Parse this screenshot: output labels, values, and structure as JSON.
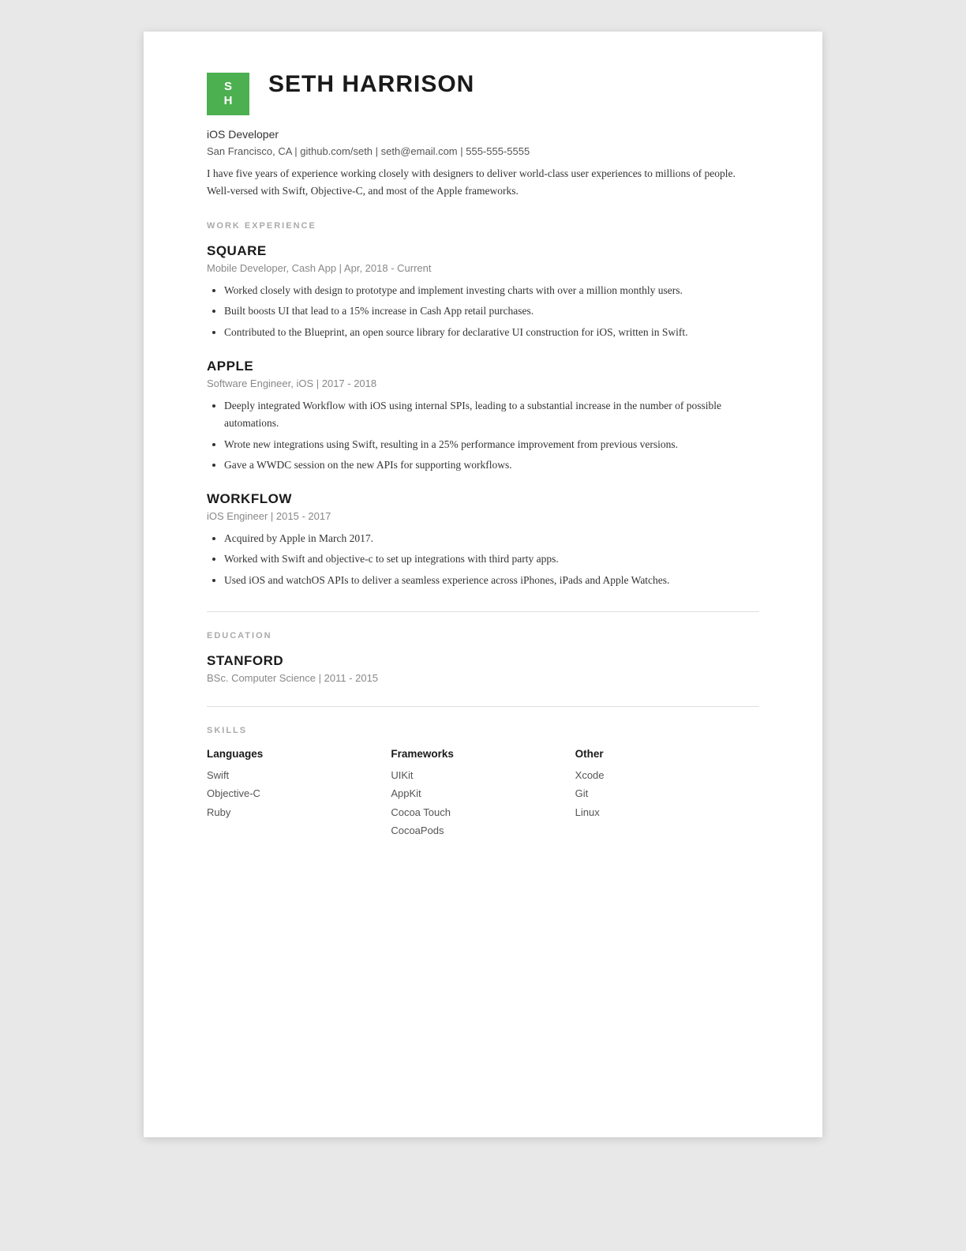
{
  "avatar": {
    "line1": "S",
    "line2": "H",
    "bg_color": "#4caf50"
  },
  "header": {
    "name": "SETH HARRISON",
    "title": "iOS Developer",
    "contact": "San Francisco, CA | github.com/seth | seth@email.com | 555-555-5555",
    "summary": "I have five years of experience working closely with designers to deliver world-class user experiences to millions of people. Well-versed with Swift, Objective-C, and most of the Apple frameworks."
  },
  "sections": {
    "work_experience_label": "WORK EXPERIENCE",
    "education_label": "EDUCATION",
    "skills_label": "SKILLS"
  },
  "work_experience": [
    {
      "company": "SQUARE",
      "meta": "Mobile Developer, Cash App | Apr, 2018 - Current",
      "bullets": [
        "Worked closely with design to prototype and implement investing charts with over a million monthly users.",
        "Built boosts UI that lead to a 15% increase in Cash App retail purchases.",
        "Contributed to the Blueprint, an open source library for declarative UI construction for iOS, written in Swift."
      ]
    },
    {
      "company": "APPLE",
      "meta": "Software Engineer, iOS | 2017 - 2018",
      "bullets": [
        "Deeply integrated Workflow with iOS using internal SPIs, leading to a substantial increase in the number of possible automations.",
        "Wrote new integrations using Swift, resulting in a 25% performance improvement from previous versions.",
        "Gave a WWDC session on the new APIs for supporting workflows."
      ]
    },
    {
      "company": "WORKFLOW",
      "meta": "iOS Engineer | 2015 - 2017",
      "bullets": [
        "Acquired by Apple in March 2017.",
        "Worked with Swift and objective-c to set up integrations with third party apps.",
        "Used iOS and watchOS APIs to deliver a seamless experience across iPhones, iPads and Apple Watches."
      ]
    }
  ],
  "education": [
    {
      "school": "STANFORD",
      "meta": "BSc. Computer Science | 2011 - 2015"
    }
  ],
  "skills": {
    "languages": {
      "header": "Languages",
      "items": [
        "Swift",
        "Objective-C",
        "Ruby"
      ]
    },
    "frameworks": {
      "header": "Frameworks",
      "items": [
        "UIKit",
        "AppKit",
        "Cocoa Touch",
        "CocoaPods"
      ]
    },
    "other": {
      "header": "Other",
      "items": [
        "Xcode",
        "Git",
        "Linux"
      ]
    }
  }
}
